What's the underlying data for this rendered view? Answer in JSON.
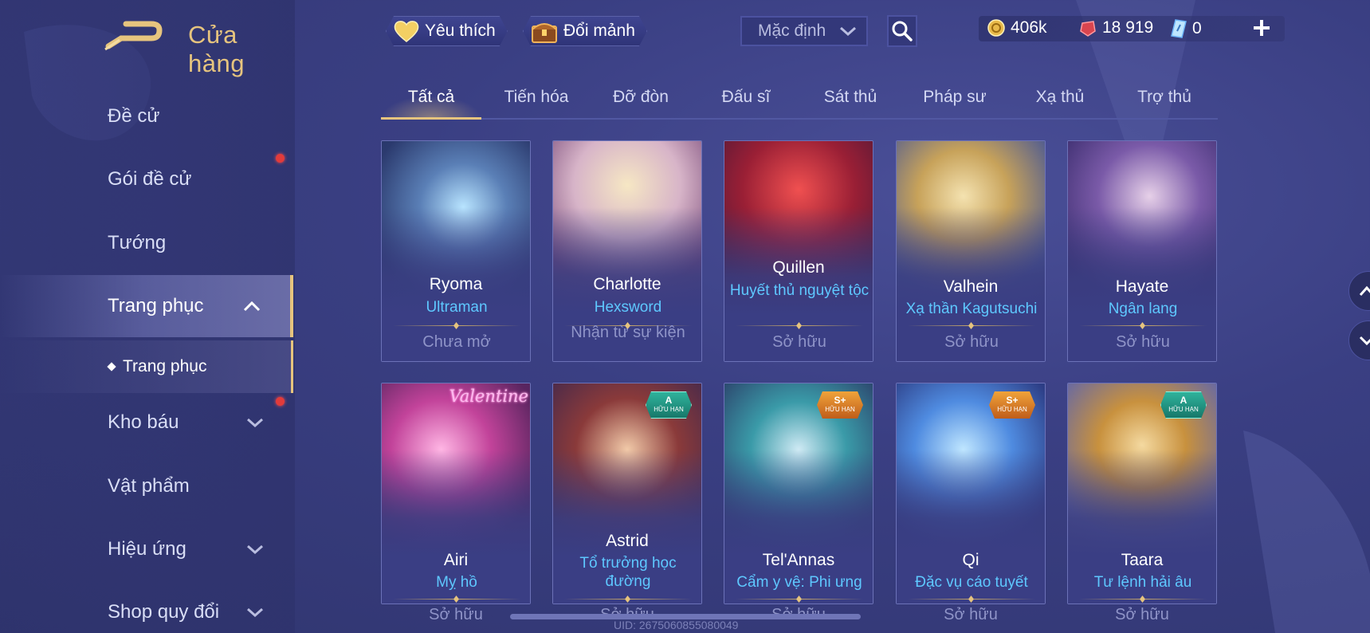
{
  "header": {
    "title": "Cửa hàng",
    "favorites_label": "Yêu thích",
    "exchange_label": "Đổi mảnh",
    "sort_selected": "Mặc định"
  },
  "currency": {
    "gold": "406k",
    "ruby": "18 919",
    "voucher": "0"
  },
  "sidebar": {
    "items": [
      {
        "label": "Đề cử"
      },
      {
        "label": "Gói đề cử"
      },
      {
        "label": "Tướng"
      },
      {
        "label": "Trang phục"
      },
      {
        "label": "Kho báu"
      },
      {
        "label": "Vật phẩm"
      },
      {
        "label": "Hiệu ứng"
      },
      {
        "label": "Shop quy đổi"
      }
    ],
    "sub_item": "Trang phục"
  },
  "tabs": [
    "Tất cả",
    "Tiến hóa",
    "Đỡ đòn",
    "Đấu sĩ",
    "Sát thủ",
    "Pháp sư",
    "Xạ thủ",
    "Trợ thủ"
  ],
  "cards": [
    {
      "hero": "Ryoma",
      "skin": "Ultraman",
      "status": "Chưa mở"
    },
    {
      "hero": "Charlotte",
      "skin": "Hexsword",
      "status": "Nhận từ sự kiện"
    },
    {
      "hero": "Quillen",
      "skin": "Huyết thủ nguyệt tộc",
      "status": "Sở hữu"
    },
    {
      "hero": "Valhein",
      "skin": "Xạ thần Kagutsuchi",
      "status": "Sở hữu"
    },
    {
      "hero": "Hayate",
      "skin": "Ngân lang",
      "status": "Sở hữu"
    },
    {
      "hero": "Airi",
      "skin": "Mỵ hồ",
      "status": "Sở hữu",
      "tag": "Valentine"
    },
    {
      "hero": "Astrid",
      "skin": "Tổ trưởng học đường",
      "status": "Sở hữu",
      "badge_grade": "A",
      "badge_sub": "HỮU HẠN"
    },
    {
      "hero": "Tel'Annas",
      "skin": "Cẩm y vệ: Phi ưng",
      "status": "Sở hữu",
      "badge_grade": "S+",
      "badge_sub": "HỮU HẠN"
    },
    {
      "hero": "Qi",
      "skin": "Đặc vụ cáo tuyết",
      "status": "Sở hữu",
      "badge_grade": "S+",
      "badge_sub": "HỮU HẠN"
    },
    {
      "hero": "Taara",
      "skin": "Tư lệnh hải âu",
      "status": "Sở hữu",
      "badge_grade": "A",
      "badge_sub": "HỮU HẠN"
    }
  ],
  "footer": {
    "uid": "UID: 2675060855080049"
  },
  "colors": {
    "accent_gold": "#e6c47e",
    "skin_name": "#5ec8ff",
    "notify_red": "#e23b3b"
  }
}
